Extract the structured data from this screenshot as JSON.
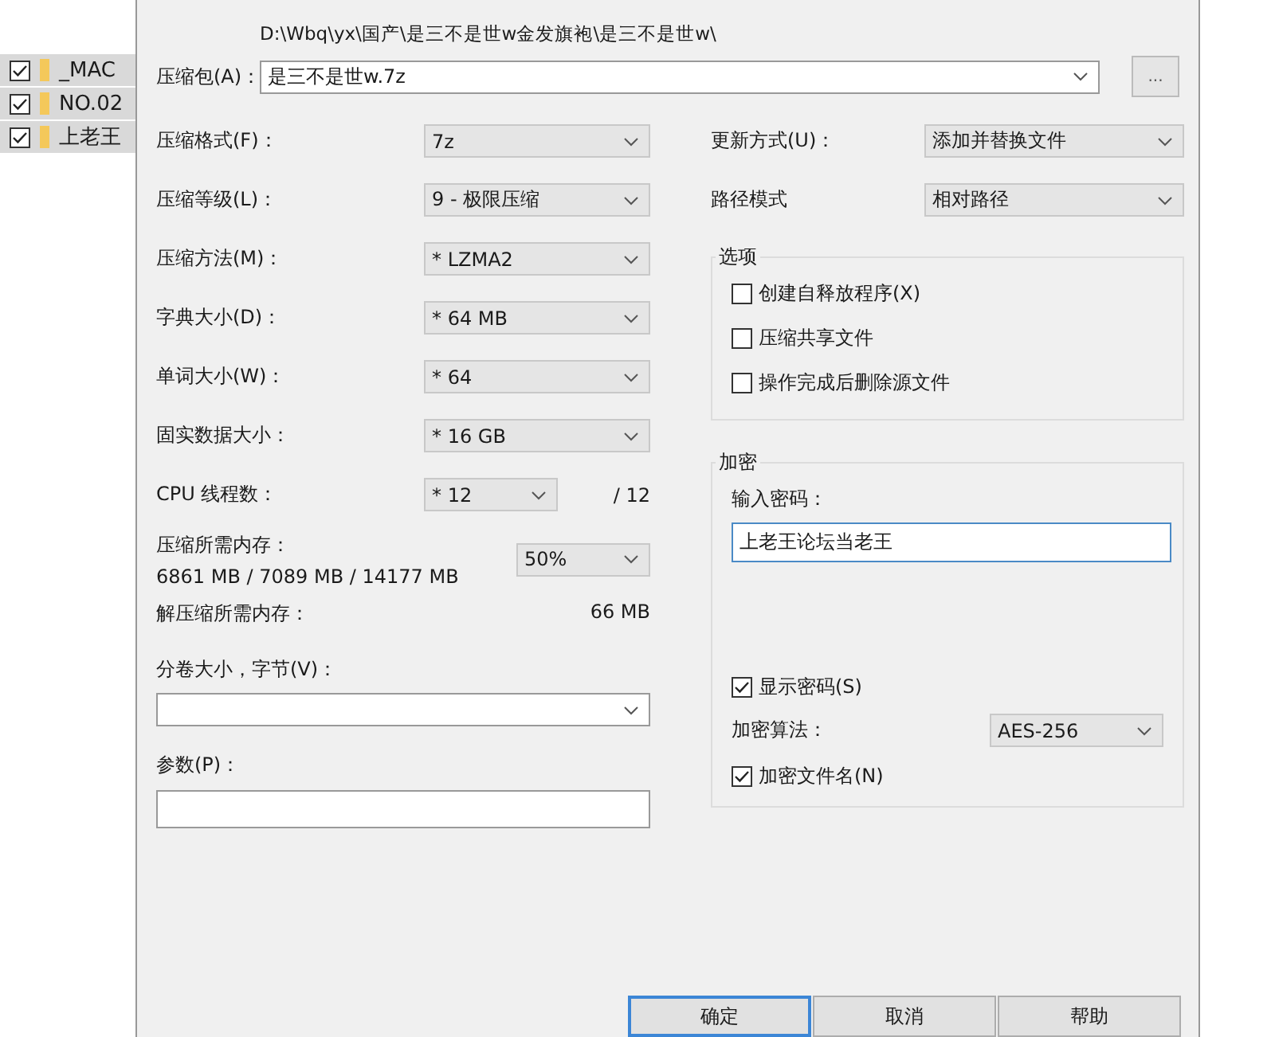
{
  "file_list": [
    {
      "name": "_MAC",
      "checked": true
    },
    {
      "name": "NO.02",
      "checked": true
    },
    {
      "name": "上老王",
      "checked": true
    }
  ],
  "archive": {
    "label": "压缩包(A)：",
    "path": "D:\\Wbq\\yx\\国产\\是三不是世w金发旗袍\\是三不是世w\\",
    "value": "是三不是世w.7z",
    "browse": "..."
  },
  "settings": [
    {
      "label": "压缩格式(F)：",
      "value": "7z"
    },
    {
      "label": "压缩等级(L)：",
      "value": "9 - 极限压缩"
    },
    {
      "label": "压缩方法(M)：",
      "value": "* LZMA2"
    },
    {
      "label": "字典大小(D)：",
      "value": "* 64 MB"
    },
    {
      "label": "单词大小(W)：",
      "value": "* 64"
    },
    {
      "label": "固实数据大小：",
      "value": "* 16 GB"
    },
    {
      "label": "CPU 线程数：",
      "value": "* 12",
      "suffix": "/ 12"
    }
  ],
  "memory": {
    "label": "压缩所需内存：",
    "detail": "6861 MB / 7089 MB / 14177 MB",
    "value": "50%"
  },
  "decompress_memory": {
    "label": "解压缩所需内存：",
    "value": "66 MB"
  },
  "volume": {
    "label": "分卷大小，字节(V)："
  },
  "parameters": {
    "label": "参数(P)："
  },
  "update_mode": {
    "label": "更新方式(U)：",
    "value": "添加并替换文件"
  },
  "path_mode": {
    "label": "路径模式",
    "value": "相对路径"
  },
  "options": {
    "title": "选项",
    "items": [
      {
        "label": "创建自释放程序(X)",
        "checked": false
      },
      {
        "label": "压缩共享文件",
        "checked": false
      },
      {
        "label": "操作完成后删除源文件",
        "checked": false
      }
    ]
  },
  "encryption": {
    "title": "加密",
    "password_label": "输入密码：",
    "password": "上老王论坛当老王",
    "show_password": {
      "label": "显示密码(S)",
      "checked": true
    },
    "method_label": "加密算法：",
    "method": "AES-256",
    "encrypt_names": {
      "label": "加密文件名(N)",
      "checked": true
    }
  },
  "buttons": [
    {
      "label": "确定",
      "default": true
    },
    {
      "label": "取消",
      "default": false
    },
    {
      "label": "帮助",
      "default": false
    }
  ]
}
